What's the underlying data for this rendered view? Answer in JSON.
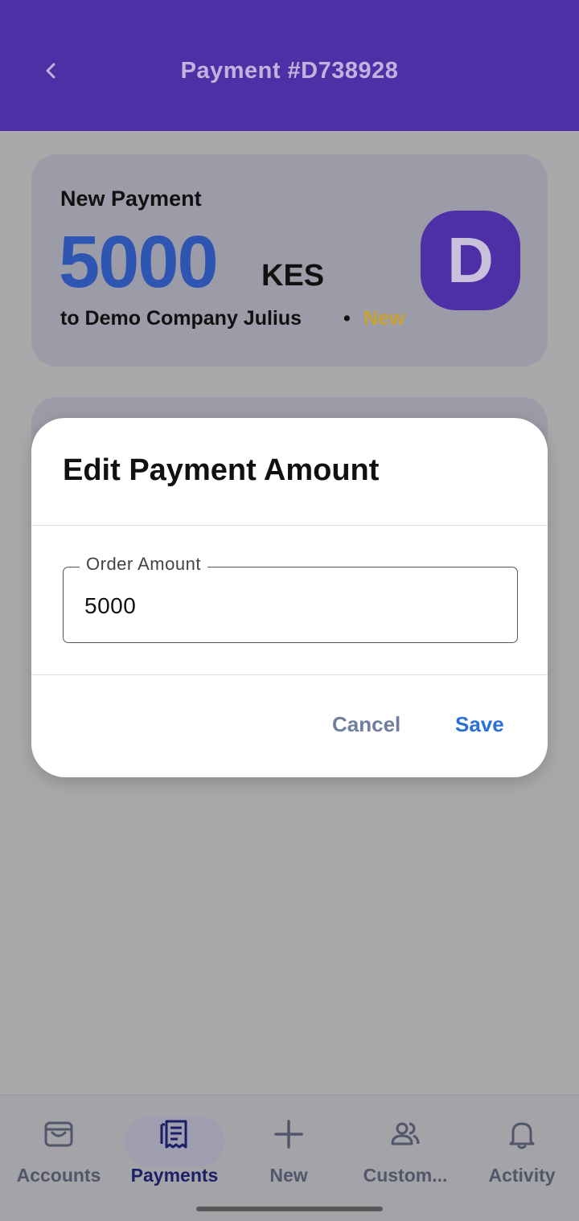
{
  "header": {
    "title": "Payment #D738928"
  },
  "payment_card": {
    "label": "New Payment",
    "amount": "5000",
    "currency": "KES",
    "recipient": "to Demo Company Julius",
    "separator": "•",
    "status": "New",
    "avatar_letter": "D"
  },
  "dialog": {
    "title": "Edit Payment Amount",
    "field_label": "Order Amount",
    "field_value": "5000",
    "cancel_label": "Cancel",
    "save_label": "Save"
  },
  "bottom_nav": {
    "items": [
      {
        "label": "Accounts",
        "icon": "wallet-icon"
      },
      {
        "label": "Payments",
        "icon": "receipt-icon",
        "active": true
      },
      {
        "label": "New",
        "icon": "plus-icon"
      },
      {
        "label": "Custom...",
        "icon": "customers-icon"
      },
      {
        "label": "Activity",
        "icon": "bell-icon"
      }
    ]
  },
  "colors": {
    "brand": "#4f2fa6",
    "amount": "#2f55b3",
    "status_new": "#c9a231",
    "save": "#2a71d6"
  }
}
